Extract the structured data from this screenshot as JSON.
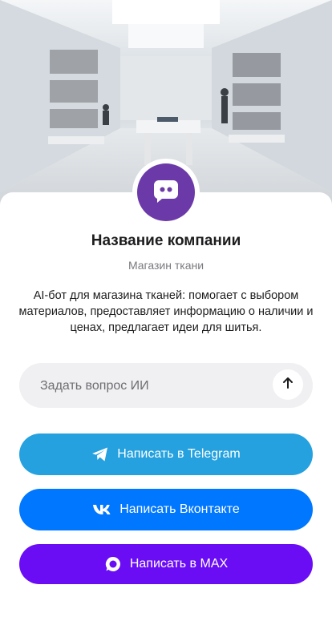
{
  "company": {
    "name": "Название компании",
    "category": "Магазин ткани",
    "description": "AI-бот для магазина тканей: помогает с выбором материалов, предоставляет информацию о наличии и ценах, предлагает идеи для шитья."
  },
  "ask": {
    "placeholder": "Задать вопрос ИИ",
    "value": ""
  },
  "buttons": {
    "telegram": "Написать в Telegram",
    "vk": "Написать Вконтакте",
    "max": "Написать в MAX"
  },
  "colors": {
    "avatar": "#6b3aa8",
    "telegram": "#24a1de",
    "vk": "#0077ff",
    "max": "#6a0df5"
  },
  "icons": {
    "avatar": "chat-bot-icon",
    "send": "arrow-up-icon",
    "telegram": "telegram-icon",
    "vk": "vk-icon",
    "max": "max-icon"
  }
}
